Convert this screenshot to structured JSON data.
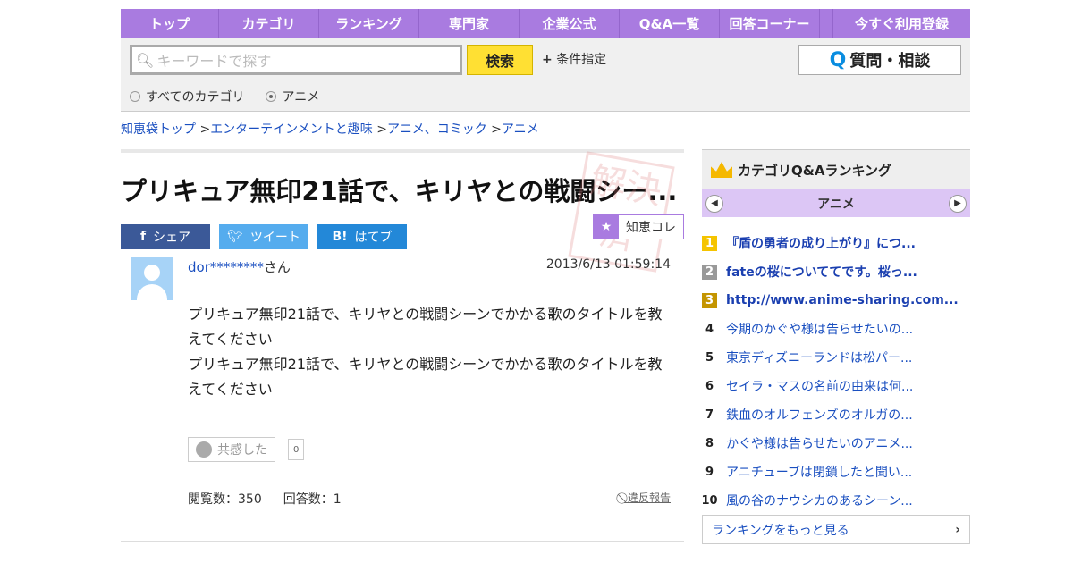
{
  "nav": [
    "トップ",
    "カテゴリ",
    "ランキング",
    "専門家",
    "企業公式",
    "Q&A一覧",
    "回答コーナー",
    "今すぐ利用登録"
  ],
  "search": {
    "placeholder": "キーワードで探す",
    "button": "検索",
    "conditions": "条件指定",
    "ask": "質問・相談",
    "radio_all": "すべてのカテゴリ",
    "radio_cat": "アニメ"
  },
  "breadcrumb": [
    "知恵袋トップ",
    "エンターテインメントと趣味",
    "アニメ、コミック",
    "アニメ"
  ],
  "question": {
    "title": "プリキュア無印21話で、キリヤとの戦闘シー...",
    "share": "シェア",
    "tweet": "ツイート",
    "hatebu": "はてブ",
    "chiekore": "知恵コレ",
    "stamp": "解決済",
    "user": "dor********",
    "san": "さん",
    "date": "2013/6/13  01:59:14",
    "body": [
      "プリキュア無印21話で、キリヤとの戦闘シーンでかかる歌のタイトルを教えてください",
      "プリキュア無印21話で、キリヤとの戦闘シーンでかかる歌のタイトルを教えてください"
    ],
    "empathy": "共感した",
    "empathy_count": "0",
    "views": "閲覧数：350",
    "answers": "回答数：1",
    "report": "違反報告"
  },
  "ranking": {
    "title": "カテゴリQ&Aランキング",
    "category": "アニメ",
    "items": [
      {
        "n": "1",
        "t": "『盾の勇者の成り上がり』につ..."
      },
      {
        "n": "2",
        "t": "fateの桜についててです。桜っ..."
      },
      {
        "n": "3",
        "t": "http://www.anime-sharing.com..."
      },
      {
        "n": "4",
        "t": "今期のかぐや様は告らせたいの..."
      },
      {
        "n": "5",
        "t": "東京ディズニーランドは松パー..."
      },
      {
        "n": "6",
        "t": "セイラ・マスの名前の由来は何..."
      },
      {
        "n": "7",
        "t": "鉄血のオルフェンズのオルガの..."
      },
      {
        "n": "8",
        "t": "かぐや様は告らせたいのアニメ..."
      },
      {
        "n": "9",
        "t": "アニチューブは閉鎖したと聞い..."
      },
      {
        "n": "10",
        "t": "風の谷のナウシカのあるシーン..."
      }
    ],
    "more": "ランキングをもっと見る"
  }
}
